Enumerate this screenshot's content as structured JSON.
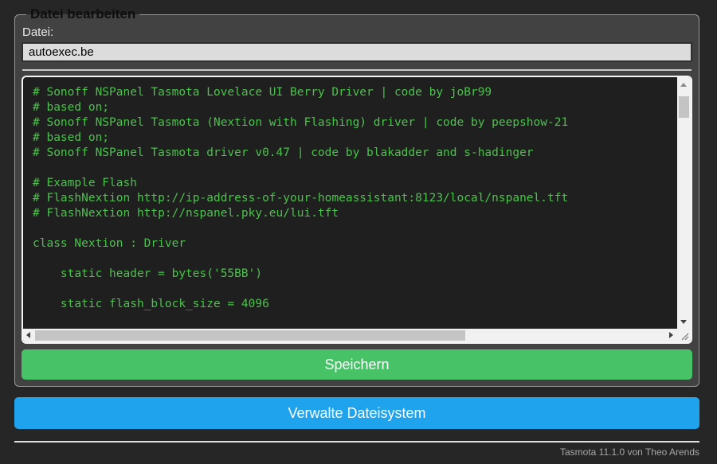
{
  "form": {
    "legend": "Datei bearbeiten",
    "file_label": "Datei:",
    "filename": "autoexec.be",
    "file_content": "# Sonoff NSPanel Tasmota Lovelace UI Berry Driver | code by joBr99\n# based on;\n# Sonoff NSPanel Tasmota (Nextion with Flashing) driver | code by peepshow-21\n# based on;\n# Sonoff NSPanel Tasmota driver v0.47 | code by blakadder and s-hadinger\n\n# Example Flash\n# FlashNextion http://ip-address-of-your-homeassistant:8123/local/nspanel.tft\n# FlashNextion http://nspanel.pky.eu/lui.tft\n\nclass Nextion : Driver\n\n    static header = bytes('55BB')\n\n    static flash_block_size = 4096",
    "save_button": "Speichern"
  },
  "buttons": {
    "manage_filesystem": "Verwalte Dateisystem"
  },
  "footer": {
    "text": "Tasmota 11.1.0 von Theo Arends"
  },
  "colors": {
    "page_bg": "#262626",
    "form_bg": "#424242",
    "console_bg": "#1f1f1f",
    "code_text": "#4bc24b",
    "save_button": "#47c266",
    "manage_button": "#1fa3ec",
    "input_bg": "#dcdcdc",
    "footer_text": "#a6a6a6"
  },
  "icons": {
    "scroll_up": "triangle-up",
    "scroll_down": "triangle-down",
    "scroll_left": "triangle-left",
    "scroll_right": "triangle-right",
    "resize_grip": "diagonal-lines"
  }
}
